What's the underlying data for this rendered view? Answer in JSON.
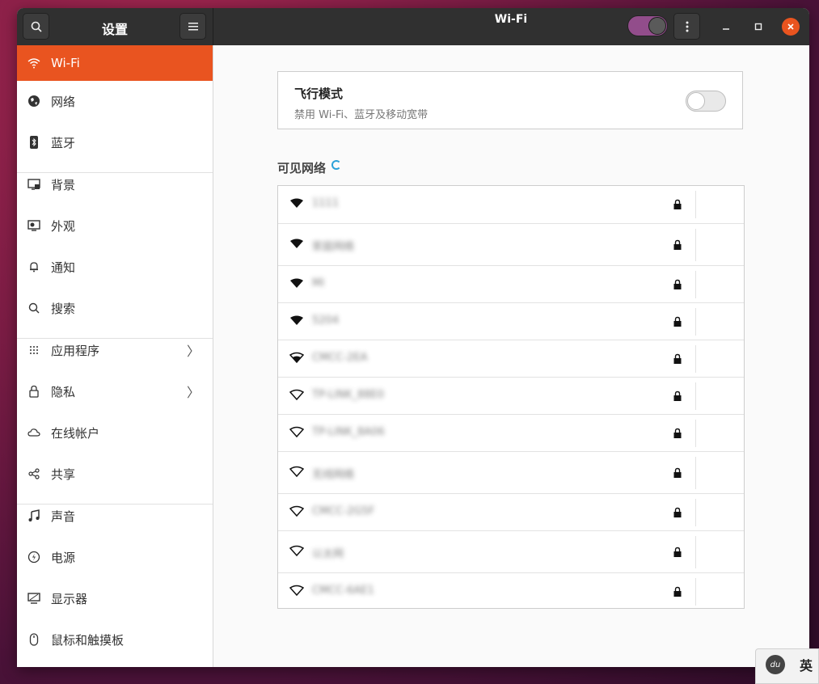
{
  "header": {
    "sidebar_title": "设置",
    "title": "Wi-Fi",
    "search_icon": "search-icon",
    "menu_icon": "hamburger-menu-icon"
  },
  "sidebar": {
    "items": [
      {
        "label": "Wi-Fi",
        "icon": "wifi-icon",
        "active": true
      },
      {
        "label": "网络",
        "icon": "globe-icon"
      },
      {
        "label": "蓝牙",
        "icon": "bluetooth-icon"
      },
      {
        "label": "背景",
        "icon": "background-icon"
      },
      {
        "label": "外观",
        "icon": "appearance-icon"
      },
      {
        "label": "通知",
        "icon": "bell-icon"
      },
      {
        "label": "搜索",
        "icon": "search-icon"
      },
      {
        "label": "应用程序",
        "icon": "apps-grid-icon",
        "arrow": true
      },
      {
        "label": "隐私",
        "icon": "lock-icon",
        "arrow": true
      },
      {
        "label": "在线帐户",
        "icon": "cloud-icon"
      },
      {
        "label": "共享",
        "icon": "share-icon"
      },
      {
        "label": "声音",
        "icon": "music-note-icon"
      },
      {
        "label": "电源",
        "icon": "power-icon"
      },
      {
        "label": "显示器",
        "icon": "display-icon"
      },
      {
        "label": "鼠标和触摸板",
        "icon": "mouse-icon"
      }
    ]
  },
  "airplane": {
    "title": "飞行模式",
    "subtitle": "禁用 Wi-Fi、蓝牙及移动宽带",
    "enabled": false
  },
  "networks": {
    "title": "可见网络",
    "items": [
      {
        "ssid": "1111",
        "signal": "strong",
        "secured": true
      },
      {
        "ssid": "家庭网络",
        "signal": "strong",
        "secured": true
      },
      {
        "ssid": "MI",
        "signal": "strong",
        "secured": true
      },
      {
        "ssid": "5204",
        "signal": "strong",
        "secured": true
      },
      {
        "ssid": "CMCC-2EA",
        "signal": "medium",
        "secured": true
      },
      {
        "ssid": "TP-LINK_88E0",
        "signal": "weak",
        "secured": true
      },
      {
        "ssid": "TP-LINK_8A06",
        "signal": "weak",
        "secured": true
      },
      {
        "ssid": "无线网络",
        "signal": "weak",
        "secured": true
      },
      {
        "ssid": "CMCC-2G5F",
        "signal": "weak",
        "secured": true
      },
      {
        "ssid": "以太网",
        "signal": "weak",
        "secured": true
      },
      {
        "ssid": "CMCC-6AE1",
        "signal": "weak",
        "secured": true
      }
    ]
  },
  "ime": {
    "logo": "du",
    "lang": "英"
  },
  "colors": {
    "accent": "#e95420",
    "toggle_on": "#924d8b"
  }
}
